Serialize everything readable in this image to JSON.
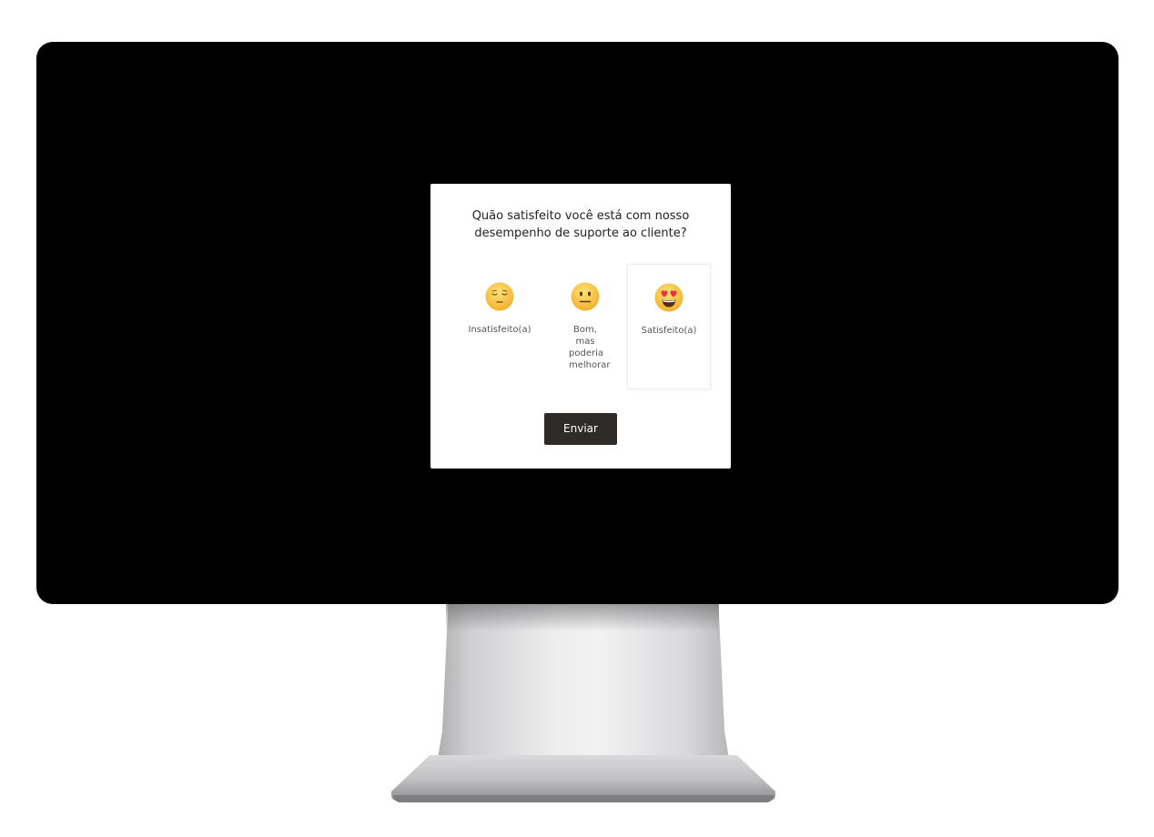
{
  "survey": {
    "question_line1": "Quão satisfeito você está com nosso",
    "question_line2": "desempenho de suporte ao cliente?",
    "options": [
      {
        "label": "Insatisfeito(a)",
        "icon": "unamused-face-icon",
        "selected": false
      },
      {
        "label": "Bom, mas poderia melhorar",
        "icon": "neutral-face-icon",
        "selected": false
      },
      {
        "label": "Satisfeito(a)",
        "icon": "heart-eyes-face-icon",
        "selected": true
      }
    ],
    "submit_label": "Enviar"
  },
  "colors": {
    "screen": "#000000",
    "dialog_bg": "#ffffff",
    "button_bg": "#2f2b29",
    "emoji_yellow": "#f7c33b",
    "heart_red": "#e8313a"
  }
}
